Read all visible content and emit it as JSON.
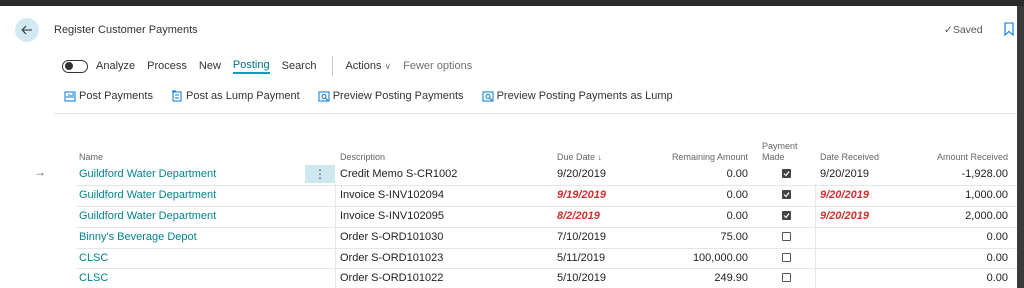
{
  "page": {
    "title": "Register Customer Payments",
    "saved_label": "Saved"
  },
  "menu": {
    "analyze": "Analyze",
    "items": [
      "Process",
      "New",
      "Posting",
      "Search"
    ],
    "active": "Posting",
    "actions": "Actions",
    "fewer": "Fewer options"
  },
  "toolbar": {
    "post_payments": "Post Payments",
    "post_lump": "Post as Lump Payment",
    "preview_posting": "Preview Posting Payments",
    "preview_lump": "Preview Posting Payments as Lump"
  },
  "columns": {
    "name": "Name",
    "description": "Description",
    "due_date": "Due Date",
    "remaining": "Remaining Amount",
    "payment_made_1": "Payment",
    "payment_made_2": "Made",
    "date_received": "Date Received",
    "amount_received": "Amount Received"
  },
  "rows": [
    {
      "name": "Guildford Water Department",
      "description": "Credit Memo S-CR1002",
      "due_date": "9/20/2019",
      "due_overdue": false,
      "remaining": "0.00",
      "payment_made": true,
      "date_received": "9/20/2019",
      "date_overdue": false,
      "amount_received": "-1,928.00"
    },
    {
      "name": "Guildford Water Department",
      "description": "Invoice S-INV102094",
      "due_date": "9/19/2019",
      "due_overdue": true,
      "remaining": "0.00",
      "payment_made": true,
      "date_received": "9/20/2019",
      "date_overdue": true,
      "amount_received": "1,000.00"
    },
    {
      "name": "Guildford Water Department",
      "description": "Invoice S-INV102095",
      "due_date": "8/2/2019",
      "due_overdue": true,
      "remaining": "0.00",
      "payment_made": true,
      "date_received": "9/20/2019",
      "date_overdue": true,
      "amount_received": "2,000.00"
    },
    {
      "name": "Binny's Beverage Depot",
      "description": "Order S-ORD101030",
      "due_date": "7/10/2019",
      "due_overdue": false,
      "remaining": "75.00",
      "payment_made": false,
      "date_received": "",
      "date_overdue": false,
      "amount_received": "0.00"
    },
    {
      "name": "CLSC",
      "description": "Order S-ORD101023",
      "due_date": "5/11/2019",
      "due_overdue": false,
      "remaining": "100,000.00",
      "payment_made": false,
      "date_received": "",
      "date_overdue": false,
      "amount_received": "0.00"
    },
    {
      "name": "CLSC",
      "description": "Order S-ORD101022",
      "due_date": "5/10/2019",
      "due_overdue": false,
      "remaining": "249.90",
      "payment_made": false,
      "date_received": "",
      "date_overdue": false,
      "amount_received": "0.00"
    }
  ],
  "colors": {
    "link": "#00838F",
    "accent": "#00A3BB",
    "overdue": "#d32f2f"
  }
}
